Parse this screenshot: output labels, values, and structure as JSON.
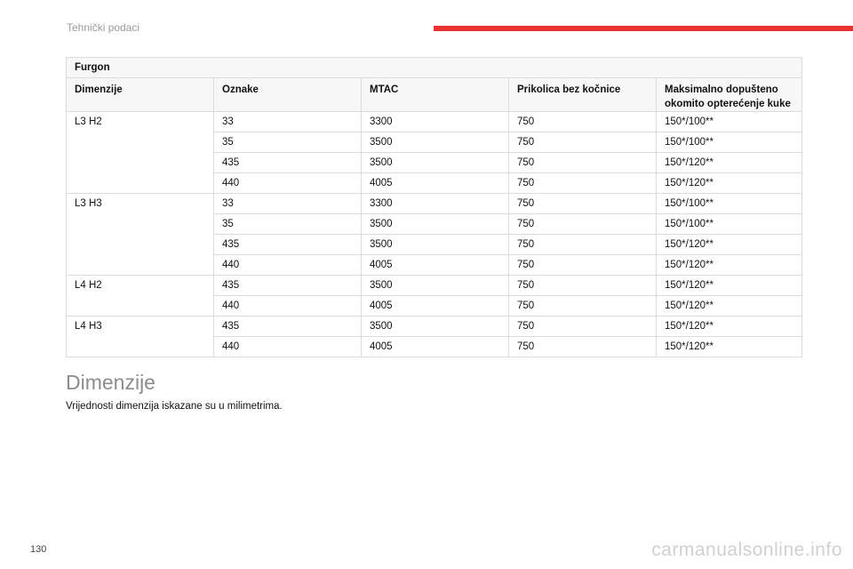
{
  "header": {
    "title": "Tehnički podaci",
    "accent_color": "#e8322f"
  },
  "table": {
    "caption": "Furgon",
    "columns": [
      "Dimenzije",
      "Oznake",
      "MTAC",
      "Prikolica bez kočnice",
      "Maksimalno dopušteno okomito opterećenje kuke"
    ],
    "groups": [
      {
        "dimension": "L3 H2",
        "rows": [
          [
            "33",
            "3300",
            "750",
            "150*/100**"
          ],
          [
            "35",
            "3500",
            "750",
            "150*/100**"
          ],
          [
            "435",
            "3500",
            "750",
            "150*/120**"
          ],
          [
            "440",
            "4005",
            "750",
            "150*/120**"
          ]
        ]
      },
      {
        "dimension": "L3 H3",
        "rows": [
          [
            "33",
            "3300",
            "750",
            "150*/100**"
          ],
          [
            "35",
            "3500",
            "750",
            "150*/100**"
          ],
          [
            "435",
            "3500",
            "750",
            "150*/120**"
          ],
          [
            "440",
            "4005",
            "750",
            "150*/120**"
          ]
        ]
      },
      {
        "dimension": "L4 H2",
        "rows": [
          [
            "435",
            "3500",
            "750",
            "150*/120**"
          ],
          [
            "440",
            "4005",
            "750",
            "150*/120**"
          ]
        ]
      },
      {
        "dimension": "L4 H3",
        "rows": [
          [
            "435",
            "3500",
            "750",
            "150*/120**"
          ],
          [
            "440",
            "4005",
            "750",
            "150*/120**"
          ]
        ]
      }
    ]
  },
  "section": {
    "title": "Dimenzije",
    "text": "Vrijednosti dimenzija iskazane su u milimetrima."
  },
  "page_number": "130",
  "watermark": "carmanualsonline.info"
}
